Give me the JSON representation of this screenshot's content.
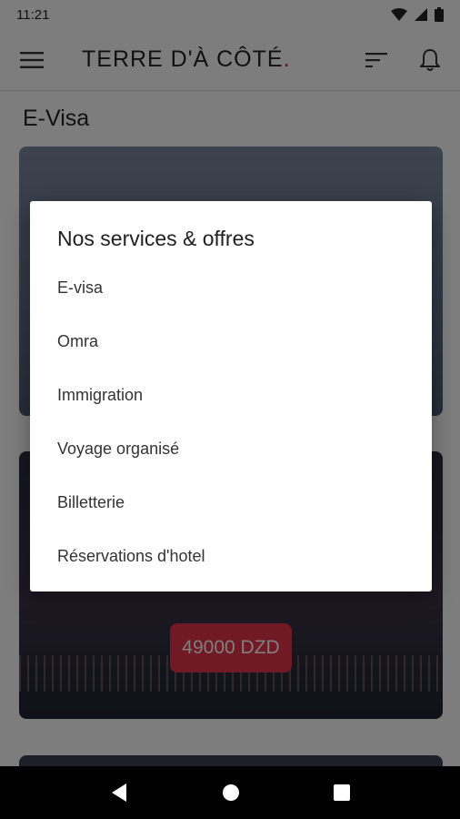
{
  "status_bar": {
    "time": "11:21"
  },
  "app_bar": {
    "title_main": "TERRE D'À CÔTÉ",
    "title_dot": "."
  },
  "page": {
    "title": "E-Visa"
  },
  "cards": [
    {
      "price": "49000 DZD"
    }
  ],
  "dialog": {
    "title": "Nos services & offres",
    "items": [
      {
        "label": "E-visa"
      },
      {
        "label": "Omra"
      },
      {
        "label": "Immigration"
      },
      {
        "label": "Voyage organisé"
      },
      {
        "label": "Billetterie"
      },
      {
        "label": "Réservations d'hotel"
      }
    ]
  },
  "colors": {
    "accent": "#e2344a",
    "logo_dot": "#c0283b"
  },
  "icons": [
    "wifi-icon",
    "signal-icon",
    "battery-icon",
    "menu-icon",
    "sort-icon",
    "bell-icon",
    "back-icon",
    "home-icon",
    "recents-icon"
  ]
}
